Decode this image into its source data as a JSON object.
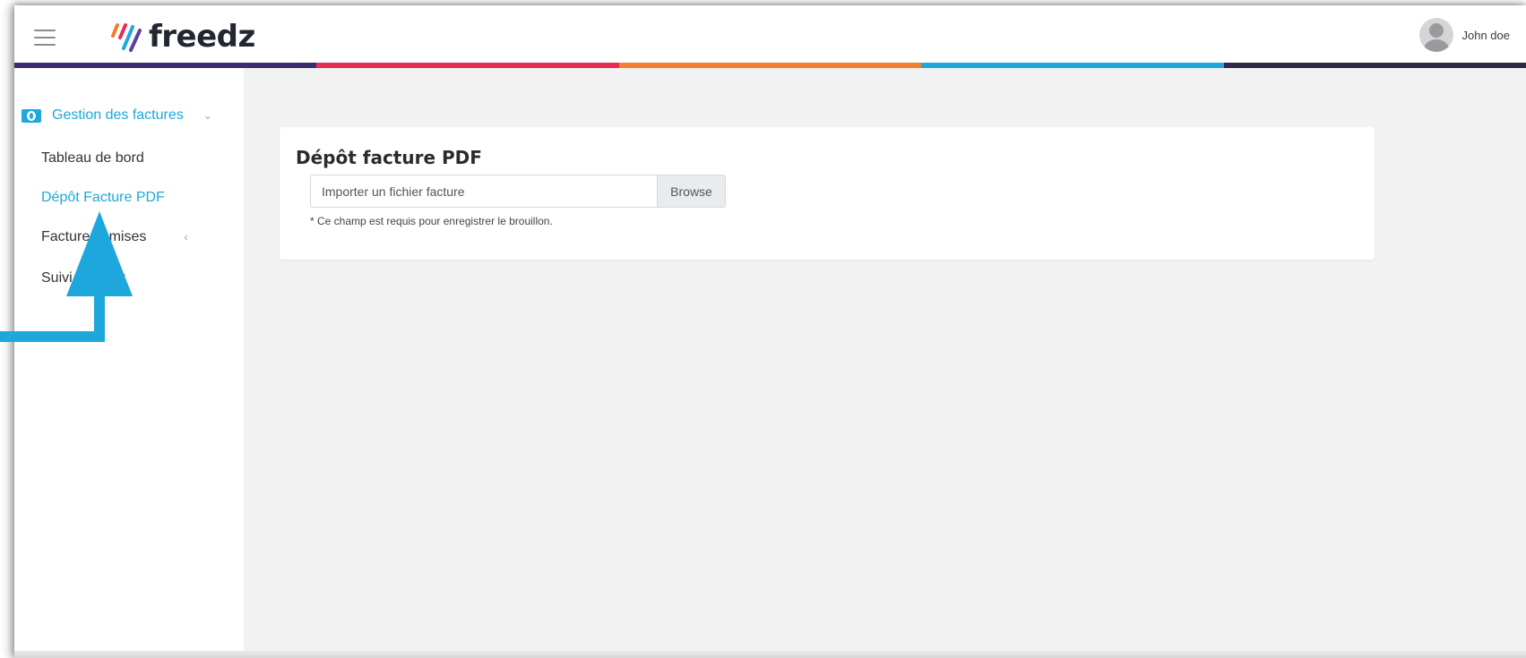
{
  "header": {
    "brand": "freedz",
    "user_name": "John doe"
  },
  "colors": {
    "accent": "#1ea7dc",
    "bar": [
      "#3d2c6e",
      "#e52e53",
      "#f27f2b",
      "#1ea7dc",
      "#2d2a45"
    ]
  },
  "sidebar": {
    "group_label": "Gestion des factures",
    "items": [
      {
        "label": "Tableau de bord"
      },
      {
        "label": "Dépôt Facture PDF"
      },
      {
        "label": "Factures émises"
      },
      {
        "label": "Suivi des flux"
      }
    ]
  },
  "main": {
    "title": "Dépôt facture PDF",
    "file_placeholder": "Importer un fichier facture",
    "browse_label": "Browse",
    "help_text": "* Ce champ est requis pour enregistrer le brouillon."
  }
}
